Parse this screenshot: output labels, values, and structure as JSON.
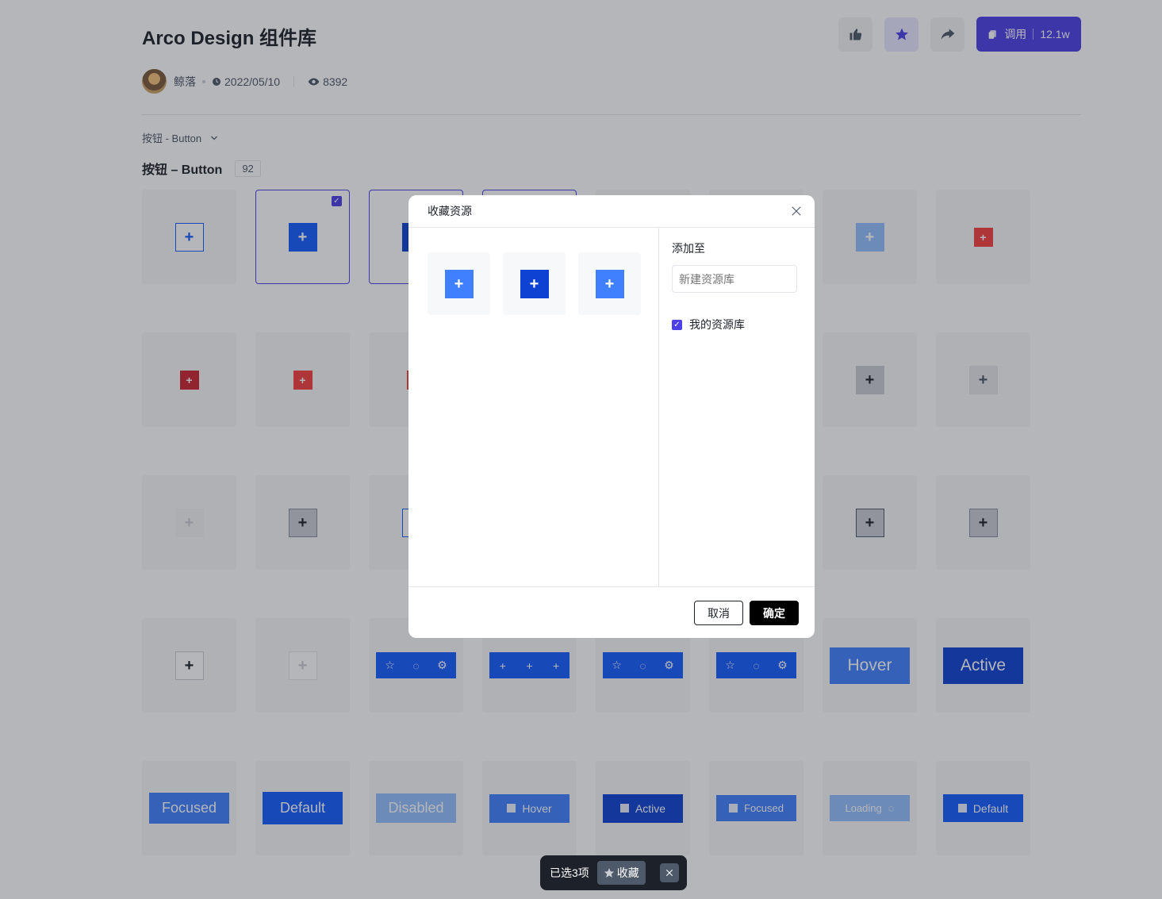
{
  "header": {
    "title": "Arco Design 组件库",
    "use_label": "调用",
    "use_count": "12.1w"
  },
  "meta": {
    "author": "鲸落",
    "date": "2022/05/10",
    "views": "8392"
  },
  "breadcrumb": {
    "label": "按钮 - Button"
  },
  "section": {
    "title": "按钮 – Button",
    "count": "92"
  },
  "cards": {
    "plus": "+",
    "hover": "Hover",
    "active": "Active",
    "focused": "Focused",
    "default": "Default",
    "disabled": "Disabled",
    "loading": "Loading"
  },
  "modal": {
    "title": "收藏资源",
    "add_to_label": "添加至",
    "new_library_placeholder": "新建资源库",
    "library_name": "我的资源库",
    "cancel_label": "取消",
    "ok_label": "确定"
  },
  "toast": {
    "selected_text": "已选3项",
    "favorite_label": "收藏"
  },
  "colors": {
    "accent": "#4c40e6",
    "primary_blue": "#165dff",
    "dark_blue": "#0e42d2",
    "light_blue": "#94bfff",
    "red": "#f53f3f"
  }
}
